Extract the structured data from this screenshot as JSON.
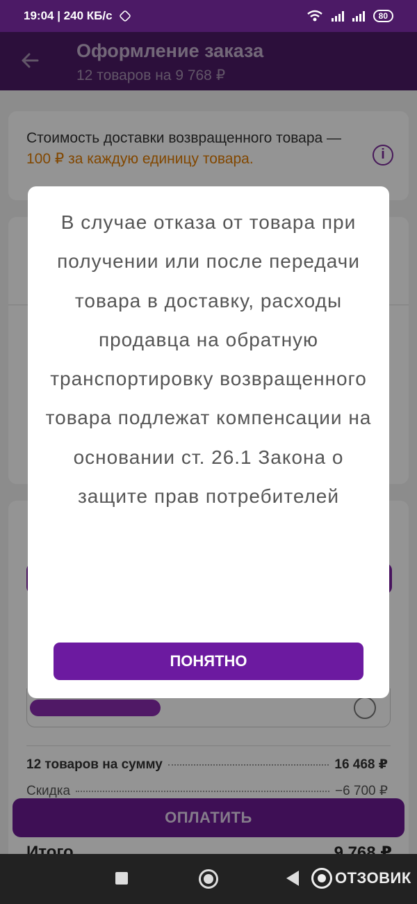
{
  "status_bar": {
    "time_speed": "19:04 | 240 КБ/с",
    "battery": "80"
  },
  "app_bar": {
    "title": "Оформление заказа",
    "subtitle": "12 товаров на 9 768 ₽"
  },
  "delivery_card": {
    "text": "Стоимость доставки возвращенного товара —",
    "highlight": "100 ₽ за каждую единицу товара."
  },
  "summary": {
    "items_label": "12 товаров на сумму",
    "items_value": "16 468 ₽",
    "discount_label": "Скидка",
    "discount_value": "−6 700 ₽",
    "total_label": "Итого",
    "total_value": "9 768 ₽"
  },
  "pay_button": "ОПЛАТИТЬ",
  "dialog": {
    "message": "В случае отказа от товара при получении или после передачи товара в доставку, расходы продавца на обратную транспортировку возвращенного товара подлежат компенсации на основании ст. 26.1 Закона о защите прав потребителей",
    "ok_button": "ПОНЯТНО"
  },
  "watermark": "ОТЗОВИК",
  "colors": {
    "brand": "#6c1aa0",
    "accent_orange": "#e07b00"
  }
}
